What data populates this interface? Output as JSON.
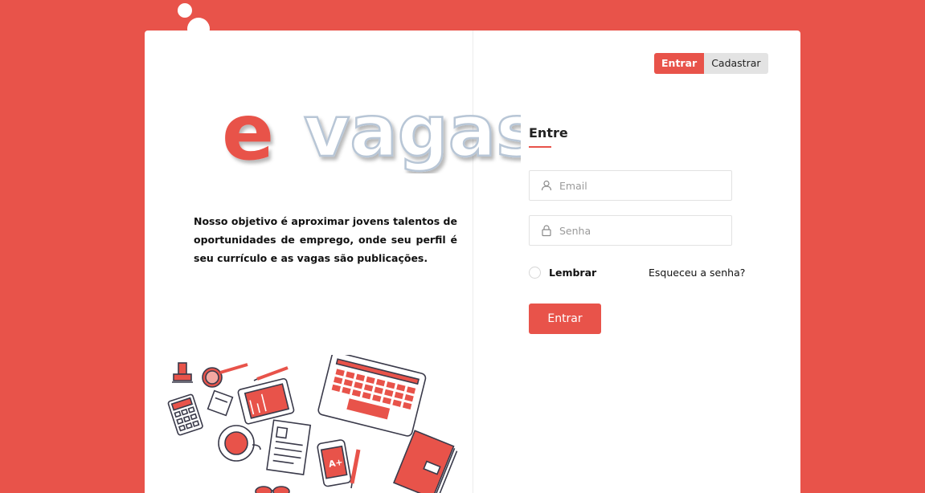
{
  "brand": {
    "logo_letter": "e",
    "logo_word": "vagas",
    "accent_color": "#e8534a",
    "background_color": "#e8534a"
  },
  "intro": {
    "mission_text": "Nosso objetivo é aproximar jovens talentos de oportunidades de emprego, onde seu perfil é seu currículo e as vagas são publicações."
  },
  "toggle": {
    "login_label": "Entrar",
    "register_label": "Cadastrar",
    "active": "login"
  },
  "login_form": {
    "title": "Entre",
    "email_placeholder": "Email",
    "email_value": "",
    "email_icon": "user-icon",
    "password_placeholder": "Senha",
    "password_value": "",
    "password_icon": "lock-icon",
    "remember_label": "Lembrar",
    "remember_checked": false,
    "forgot_label": "Esqueceu a senha?",
    "submit_label": "Entrar"
  },
  "illustration": {
    "icons": [
      "stamp-icon",
      "magnifier-icon",
      "pencil-icon",
      "calculator-icon",
      "sticky-note-icon",
      "tablet-icon",
      "laptop-icon",
      "coffee-cup-icon",
      "document-icon",
      "phone-icon",
      "pen-icon",
      "notebook-icon",
      "glasses-icon"
    ]
  }
}
